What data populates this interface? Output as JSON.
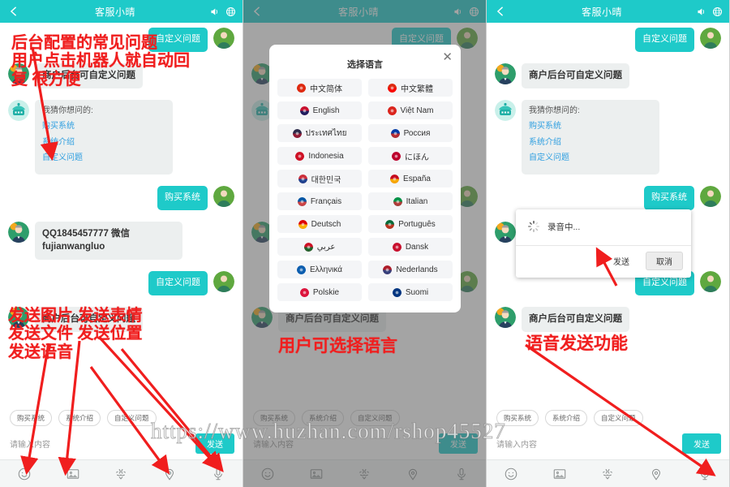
{
  "app": {
    "header_title": "客服小晴",
    "accent": "#1ECAC9",
    "annotation_color": "#F01E1E",
    "bubble_bg": "#ECEFEF",
    "link_color": "#2F9FE0"
  },
  "header": {
    "back_icon": "chevron-left-icon",
    "title": "客服小晴",
    "sound_icon": "speaker-icon",
    "language_icon": "globe-icon"
  },
  "chat": {
    "user_msg_1": "自定义问题",
    "agent_msg_1": "商户后台可自定义问题",
    "bot_prompt": "我猜你想问的:",
    "bot_links": [
      "购买系统",
      "系统介绍",
      "自定义问题"
    ],
    "user_msg_2": "购买系统",
    "agent_msg_2": "QQ1845457777 微信fujianwangluo",
    "user_msg_3": "自定义问题",
    "agent_msg_3": "商户后台可自定义问题"
  },
  "footer": {
    "chips": [
      "购买系统",
      "系统介绍",
      "自定义问题"
    ],
    "input_placeholder": "请输入内容",
    "send_label": "发送",
    "toolbar_icons": [
      "smiley-icon",
      "image-icon",
      "file-icon",
      "location-icon",
      "microphone-icon"
    ]
  },
  "language_dialog": {
    "title": "选择语言",
    "close_label": "✕",
    "options": [
      {
        "label": "中文简体",
        "flag": "cn"
      },
      {
        "label": "中文繁體",
        "flag": "tw"
      },
      {
        "label": "English",
        "flag": "uk"
      },
      {
        "label": "Việt Nam",
        "flag": "vn"
      },
      {
        "label": "ประเทศไทย",
        "flag": "th"
      },
      {
        "label": "Россия",
        "flag": "ru"
      },
      {
        "label": "Indonesia",
        "flag": "id"
      },
      {
        "label": "にほん",
        "flag": "jp"
      },
      {
        "label": "대한민국",
        "flag": "kr"
      },
      {
        "label": "España",
        "flag": "es"
      },
      {
        "label": "Français",
        "flag": "fr"
      },
      {
        "label": "Italian",
        "flag": "it"
      },
      {
        "label": "Deutsch",
        "flag": "de"
      },
      {
        "label": "Português",
        "flag": "pt"
      },
      {
        "label": "عربي",
        "flag": "ae"
      },
      {
        "label": "Dansk",
        "flag": "dk"
      },
      {
        "label": "Ελληνικά",
        "flag": "gr"
      },
      {
        "label": "Nederlands",
        "flag": "nl"
      },
      {
        "label": "Polskie",
        "flag": "pl"
      },
      {
        "label": "Suomi",
        "flag": "fi"
      }
    ]
  },
  "recording_dialog": {
    "status_text": "录音中...",
    "send_label": "发送",
    "cancel_label": "取消",
    "spinner_icon": "spinner-icon"
  },
  "annotations": {
    "panel1_top": "后台配置的常见问题\n用户点击机器人就自动回\n复 很方便",
    "panel1_mid": "发送图片 发送表情\n发送文件 发送位置\n发送语音",
    "panel2": "用户可选择语言",
    "panel3": "语音发送功能"
  },
  "watermark": {
    "text": "https://www.huzhan.com/rshop45527"
  }
}
